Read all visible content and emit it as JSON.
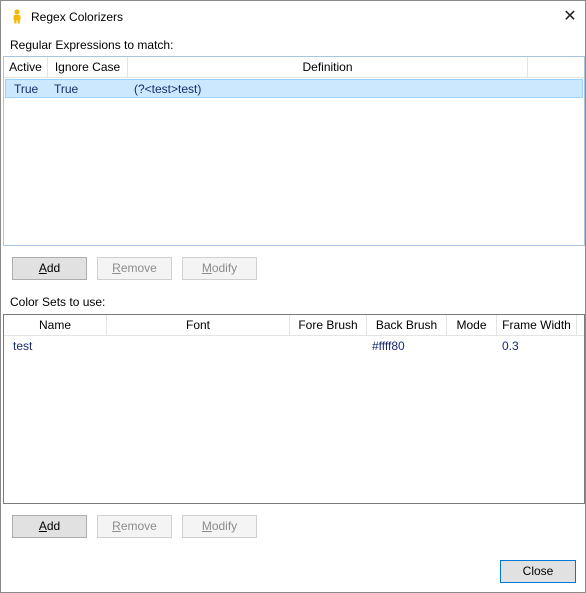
{
  "window": {
    "title": "Regex Colorizers",
    "close_glyph": "✕",
    "icon": "person-icon"
  },
  "regex_section": {
    "label": "Regular Expressions to match:",
    "columns": [
      "Active",
      "Ignore Case",
      "Definition"
    ],
    "rows": [
      {
        "active": "True",
        "ignore_case": "True",
        "definition": "(?<test>test)",
        "selected": true
      }
    ],
    "buttons": {
      "add_mnemonic": "A",
      "add_rest": "dd",
      "remove_mnemonic": "R",
      "remove_rest": "emove",
      "modify_mnemonic": "M",
      "modify_rest": "odify"
    }
  },
  "colorset_section": {
    "label": "Color Sets to use:",
    "columns": [
      "Name",
      "Font",
      "Fore Brush",
      "Back Brush",
      "Mode",
      "Frame Width"
    ],
    "rows": [
      {
        "name": "test",
        "font": "",
        "fore_brush": "",
        "back_brush": "#ffff80",
        "mode": "",
        "frame_width": "0.3"
      }
    ],
    "buttons": {
      "add_mnemonic": "A",
      "add_rest": "dd",
      "remove_mnemonic": "R",
      "remove_rest": "emove",
      "modify_mnemonic": "M",
      "modify_rest": "odify"
    }
  },
  "footer": {
    "close_label": "Close"
  },
  "colors": {
    "selection_bg": "#cce8ff",
    "listview_border": "#a8c4e0",
    "row_text": "#1a2a6c",
    "icon_accent": "#f2b90a"
  }
}
